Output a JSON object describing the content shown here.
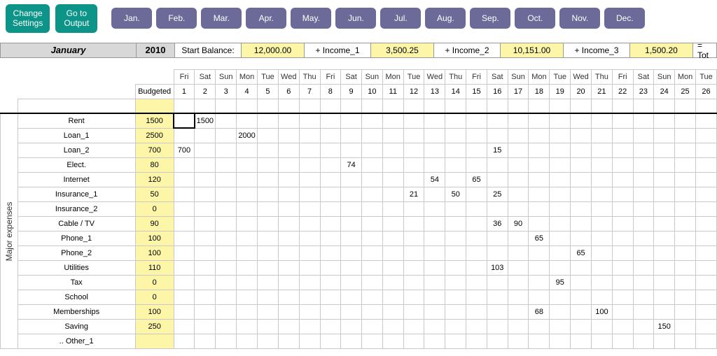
{
  "buttons": {
    "settings": "Change\nSettings",
    "output": "Go to\nOutput"
  },
  "months": [
    "Jan.",
    "Feb.",
    "Mar.",
    "Apr.",
    "May.",
    "Jun.",
    "Jul.",
    "Aug.",
    "Sep.",
    "Oct.",
    "Nov.",
    "Dec."
  ],
  "summary": {
    "month": "January",
    "year": "2010",
    "start_balance_label": "Start Balance:",
    "start_balance": "12,000.00",
    "inc1_label": "+ Income_1",
    "inc1": "3,500.25",
    "inc2_label": "+ Income_2",
    "inc2": "10,151.00",
    "inc3_label": "+ Income_3",
    "inc3": "1,500.20",
    "total_label": "= Tot"
  },
  "budgeted_label": "Budgeted",
  "side_label": "Major expenses",
  "dow": [
    "Fri",
    "Sat",
    "Sun",
    "Mon",
    "Tue",
    "Wed",
    "Thu",
    "Fri",
    "Sat",
    "Sun",
    "Mon",
    "Tue",
    "Wed",
    "Thu",
    "Fri",
    "Sat",
    "Sun",
    "Mon",
    "Tue",
    "Wed",
    "Thu",
    "Fri",
    "Sat",
    "Sun",
    "Mon",
    "Tue"
  ],
  "days": [
    "1",
    "2",
    "3",
    "4",
    "5",
    "6",
    "7",
    "8",
    "9",
    "10",
    "11",
    "12",
    "13",
    "14",
    "15",
    "16",
    "17",
    "18",
    "19",
    "20",
    "21",
    "22",
    "23",
    "24",
    "25",
    "26"
  ],
  "rows": [
    {
      "label": "Rent",
      "bud": "1500",
      "cells": {
        "2": "1500"
      }
    },
    {
      "label": "Loan_1",
      "bud": "2500",
      "cells": {
        "4": "2000"
      }
    },
    {
      "label": "Loan_2",
      "bud": "700",
      "cells": {
        "1": "700",
        "16": "15"
      }
    },
    {
      "label": "Elect.",
      "bud": "80",
      "cells": {
        "9": "74"
      }
    },
    {
      "label": "Internet",
      "bud": "120",
      "cells": {
        "13": "54",
        "15": "65"
      }
    },
    {
      "label": "Insurance_1",
      "bud": "50",
      "cells": {
        "12": "21",
        "14": "50",
        "16": "25"
      }
    },
    {
      "label": "Insurance_2",
      "bud": "0",
      "cells": {}
    },
    {
      "label": "Cable / TV",
      "bud": "90",
      "cells": {
        "16": "36",
        "17": "90"
      }
    },
    {
      "label": "Phone_1",
      "bud": "100",
      "cells": {
        "18": "65"
      }
    },
    {
      "label": "Phone_2",
      "bud": "100",
      "cells": {
        "20": "65"
      }
    },
    {
      "label": "Utilities",
      "bud": "110",
      "cells": {
        "16": "103"
      }
    },
    {
      "label": "Tax",
      "bud": "0",
      "cells": {
        "19": "95"
      }
    },
    {
      "label": "School",
      "bud": "0",
      "cells": {}
    },
    {
      "label": "Memberships",
      "bud": "100",
      "cells": {
        "18": "68",
        "21": "100"
      }
    },
    {
      "label": "Saving",
      "bud": "250",
      "cells": {
        "24": "150"
      }
    },
    {
      "label": ".. Other_1",
      "bud": "",
      "cells": {}
    }
  ]
}
